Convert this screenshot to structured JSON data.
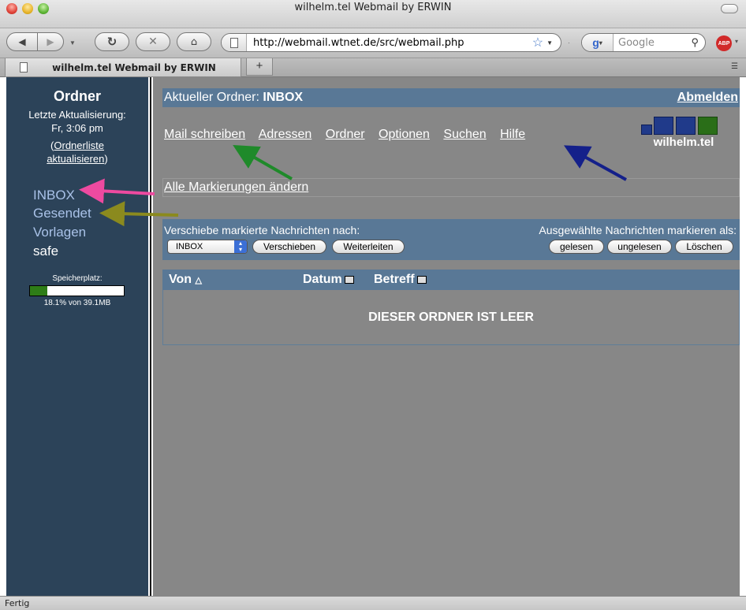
{
  "browser": {
    "window_title": "wilhelm.tel Webmail by ERWIN",
    "url": "http://webmail.wtnet.de/src/webmail.php",
    "search_placeholder": "Google",
    "search_engine_icon": "google-icon",
    "tab_title": "wilhelm.tel Webmail by ERWIN",
    "new_tab_label": "+",
    "status": "Fertig",
    "adblock_label": "ABP"
  },
  "sidebar": {
    "title": "Ordner",
    "last_update_label": "Letzte Aktualisierung:",
    "last_update_time": "Fr, 3:06 pm",
    "refresh_prefix": "(",
    "refresh_line1": "Ordnerliste",
    "refresh_line2": "aktualisieren",
    "refresh_suffix": ")",
    "folders": [
      {
        "label": "INBOX",
        "link": true
      },
      {
        "label": "Gesendet",
        "link": true
      },
      {
        "label": "Vorlagen",
        "link": true
      },
      {
        "label": "safe",
        "link": false
      }
    ],
    "quota_label": "Speicherplatz:",
    "quota_percent": 18.1,
    "quota_text": "18.1% von 39.1MB"
  },
  "header": {
    "current_folder_label": "Aktueller Ordner: ",
    "current_folder": "INBOX",
    "logout": "Abmelden"
  },
  "nav": [
    "Mail schreiben",
    "Adressen",
    "Ordner",
    "Optionen",
    "Suchen",
    "Hilfe"
  ],
  "logo": {
    "text": "wilhelm.tel",
    "square_colors": [
      "#203a8a",
      "#203a8a",
      "#203a8a",
      "#2a6e18"
    ]
  },
  "mark_all": "Alle Markierungen ändern",
  "move": {
    "label": "Verschiebe markierte Nachrichten nach:",
    "selected_folder": "INBOX",
    "move_button": "Verschieben",
    "forward_button": "Weiterleiten",
    "mark_label": "Ausgewählte Nachrichten markieren als:",
    "read_button": "gelesen",
    "unread_button": "ungelesen",
    "delete_button": "Löschen"
  },
  "table": {
    "col_from": "Von",
    "col_date": "Datum",
    "col_subject": "Betreff",
    "empty_message": "DIESER ORDNER IST LEER"
  },
  "annotation_colors": {
    "compose_arrow": "#1f8a2a",
    "help_arrow": "#14208a",
    "inbox_arrow": "#ee4aa0",
    "sent_arrow": "#8b8a1e"
  }
}
